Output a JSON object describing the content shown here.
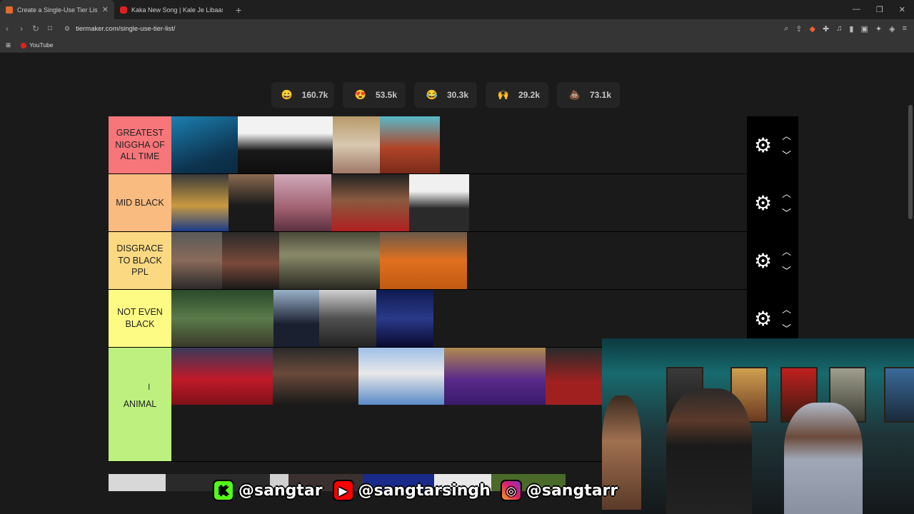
{
  "browser": {
    "tabs": [
      {
        "title": "Create a Single-Use Tier List (Pr",
        "active": true
      },
      {
        "title": "Kaka New Song | Kale Je Libaas Di (C",
        "active": false
      }
    ],
    "url": "tiermaker.com/single-use-tier-list/",
    "bookmarks": [
      {
        "label": "YouTube"
      }
    ]
  },
  "reactions": [
    {
      "emoji": "😀",
      "count": "160.7k"
    },
    {
      "emoji": "😍",
      "count": "53.5k"
    },
    {
      "emoji": "😂",
      "count": "30.3k"
    },
    {
      "emoji": "🙌",
      "count": "29.2k"
    },
    {
      "emoji": "💩",
      "count": "73.1k"
    }
  ],
  "tiers": [
    {
      "label": "GREATEST NIGGHA OF ALL TIME",
      "color": "#f7767a",
      "items": 4
    },
    {
      "label": "MID BLACK",
      "color": "#f9bb7f",
      "items": 5
    },
    {
      "label": "DISGRACE TO BLACK PPL",
      "color": "#fbd982",
      "items": 4
    },
    {
      "label": "NOT EVEN BLACK",
      "color": "#fdfb84",
      "items": 4
    },
    {
      "label": "ANIMAL",
      "color": "#bdf07e",
      "items": 6
    }
  ],
  "overlay": {
    "social": [
      {
        "icon": "K",
        "handle": "@sangtar"
      },
      {
        "icon": "▶",
        "handle": "@sangtarsingh"
      },
      {
        "icon": "◎",
        "handle": "@sangtarr"
      }
    ]
  }
}
